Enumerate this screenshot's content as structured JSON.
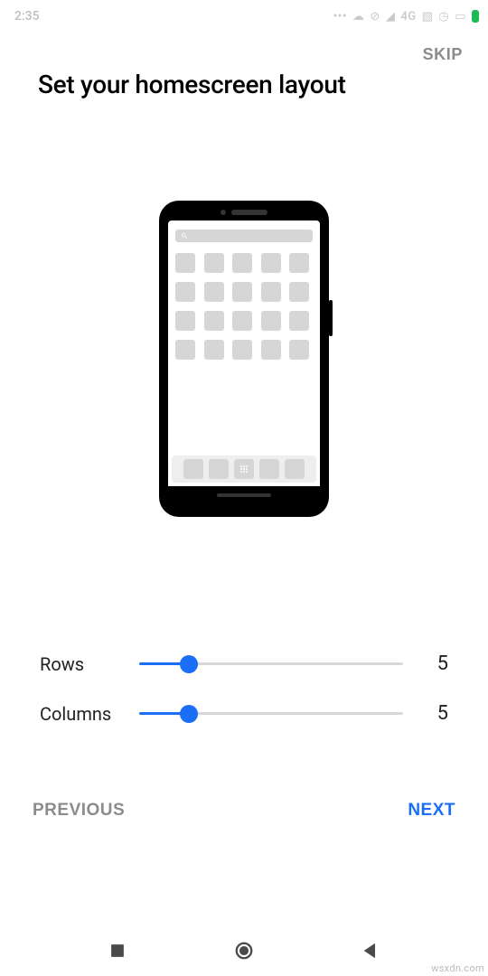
{
  "status": {
    "time": "2:35",
    "network": "4G"
  },
  "header": {
    "skip": "SKIP",
    "title": "Set your homescreen layout"
  },
  "sliders": {
    "rows": {
      "label": "Rows",
      "value": 5,
      "min": 3,
      "max": 12,
      "fillPercent": 19
    },
    "columns": {
      "label": "Columns",
      "value": 5,
      "min": 3,
      "max": 12,
      "fillPercent": 19
    }
  },
  "footer": {
    "previous": "PREVIOUS",
    "next": "NEXT"
  },
  "watermark": "wsxdn.com"
}
